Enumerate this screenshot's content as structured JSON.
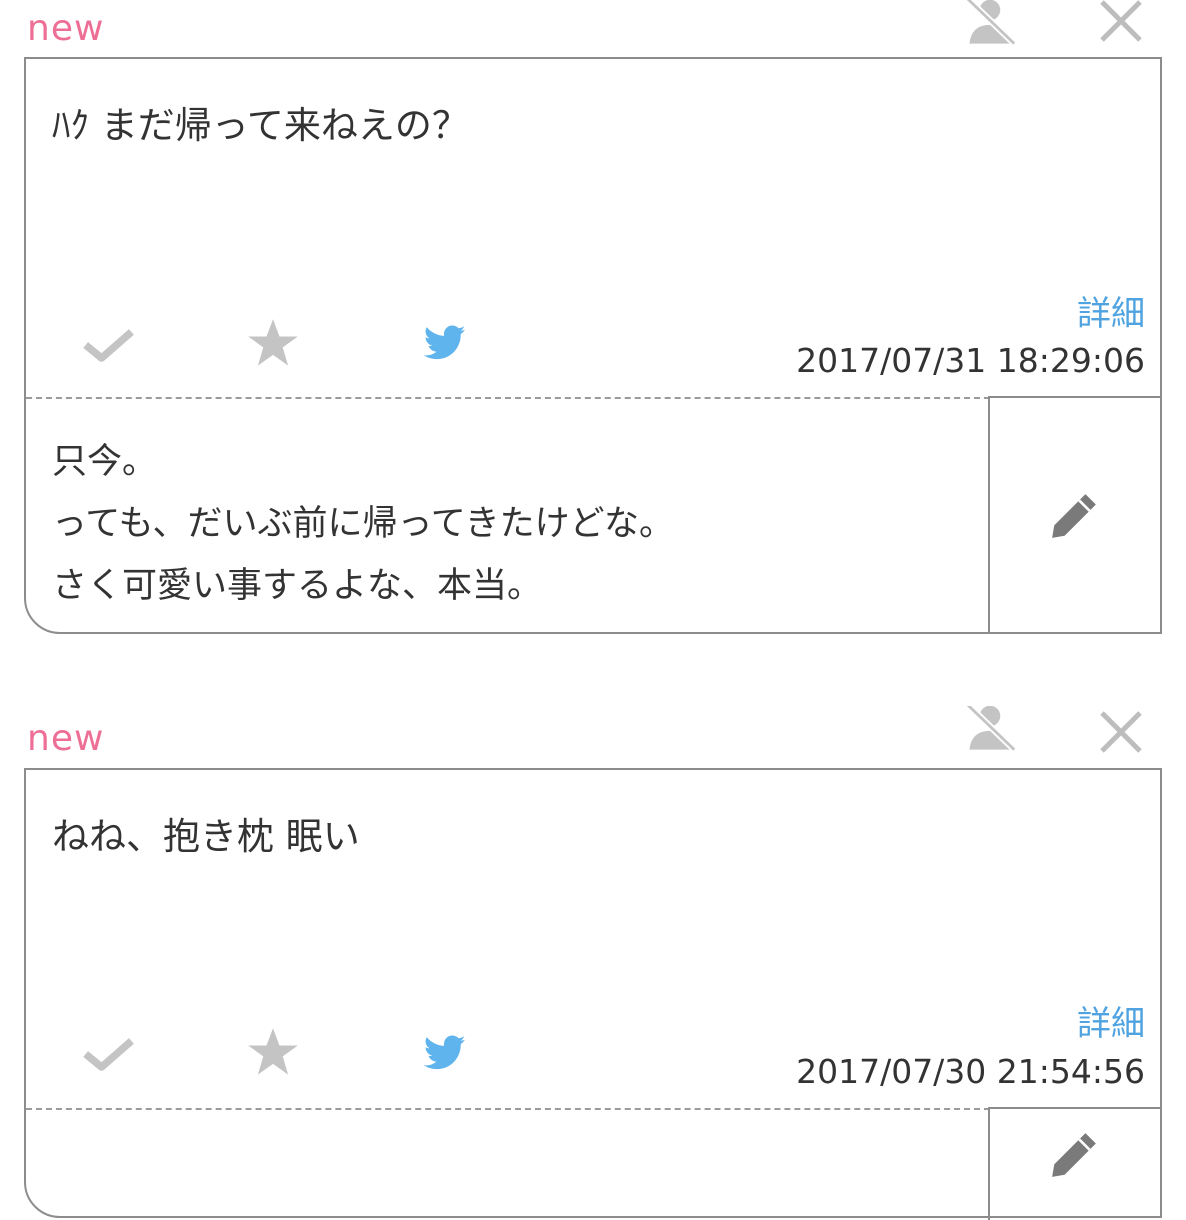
{
  "cards": [
    {
      "new_label": "new",
      "question": "ﾊｸ まだ帰って来ねえの？",
      "detail_label": "詳細",
      "timestamp": "2017/07/31 18:29:06",
      "answer_lines": [
        "只今。",
        "っても、だいぶ前に帰ってきたけどな。",
        "さく可愛い事するよな、本当。"
      ]
    },
    {
      "new_label": "new",
      "question": "ねね、抱き枕 眠い",
      "detail_label": "詳細",
      "timestamp": "2017/07/30 21:54:56",
      "answer_lines": []
    }
  ],
  "icons": {
    "hide_user": "user-blocked-icon",
    "delete": "close-icon",
    "check": "check-icon",
    "favorite": "star-icon",
    "twitter": "twitter-icon",
    "edit": "pencil-icon"
  },
  "colors": {
    "new_label": "#ee6f96",
    "detail_link": "#4ea3e0",
    "twitter": "#5fb4ee",
    "icon_gray": "#c4c4c4",
    "border": "#8c8c8c"
  }
}
